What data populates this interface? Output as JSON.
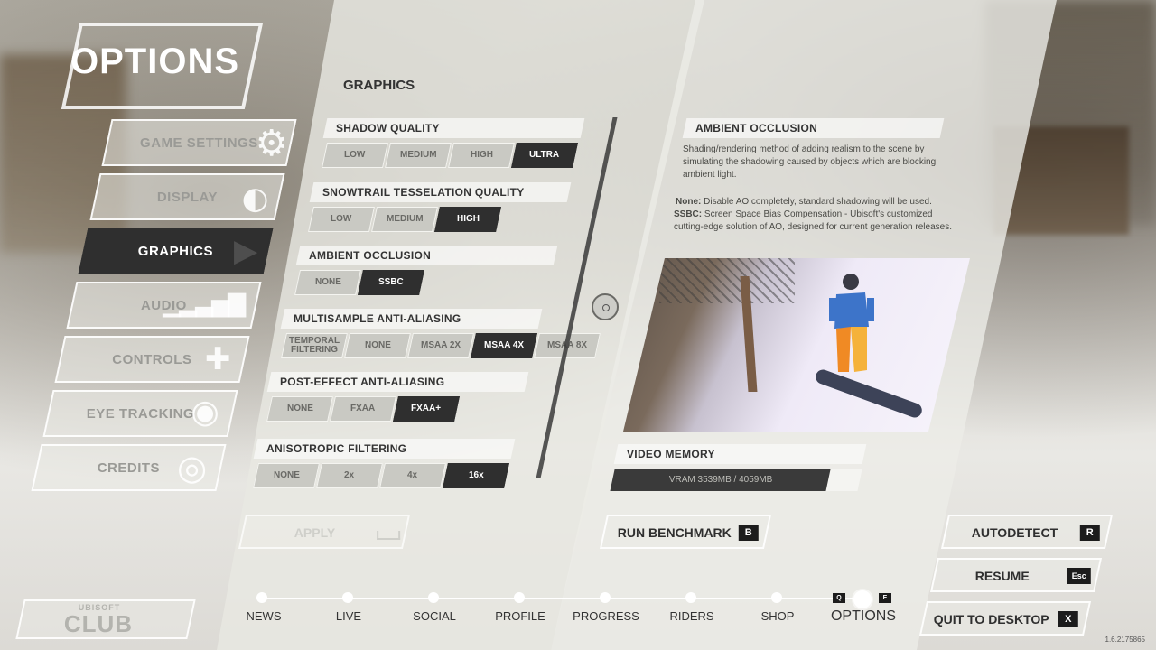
{
  "title": "OPTIONS",
  "nav": [
    {
      "label": "GAME SETTINGS",
      "active": false
    },
    {
      "label": "DISPLAY",
      "active": false
    },
    {
      "label": "GRAPHICS",
      "active": true
    },
    {
      "label": "AUDIO",
      "active": false
    },
    {
      "label": "CONTROLS",
      "active": false
    },
    {
      "label": "EYE TRACKING",
      "active": false
    },
    {
      "label": "CREDITS",
      "active": false
    }
  ],
  "graphics": {
    "heading": "GRAPHICS",
    "sections": [
      {
        "label": "SHADOW QUALITY",
        "options": [
          "LOW",
          "MEDIUM",
          "HIGH",
          "ULTRA"
        ],
        "selected": "ULTRA"
      },
      {
        "label": "SNOWTRAIL TESSELATION QUALITY",
        "options": [
          "LOW",
          "MEDIUM",
          "HIGH"
        ],
        "selected": "HIGH"
      },
      {
        "label": "AMBIENT OCCLUSION",
        "options": [
          "NONE",
          "SSBC"
        ],
        "selected": "SSBC"
      },
      {
        "label": "MULTISAMPLE ANTI-ALIASING",
        "options": [
          "TEMPORAL FILTERING",
          "NONE",
          "MSAA 2X",
          "MSAA 4X",
          "MSAA 8X"
        ],
        "selected": "MSAA 4X"
      },
      {
        "label": "POST-EFFECT ANTI-ALIASING",
        "options": [
          "NONE",
          "FXAA",
          "FXAA+"
        ],
        "selected": "FXAA+"
      },
      {
        "label": "ANISOTROPIC FILTERING",
        "options": [
          "NONE",
          "2x",
          "4x",
          "16x"
        ],
        "selected": "16x"
      }
    ],
    "apply_label": "APPLY"
  },
  "info": {
    "title": "AMBIENT OCCLUSION",
    "description": "Shading/rendering method of adding realism to the scene by simulating the shadowing caused by objects which are blocking ambient light.",
    "none_label": "None:",
    "none_text": "Disable AO completely, standard shadowing will be used.",
    "ssbc_label": "SSBC:",
    "ssbc_text": "Screen Space Bias Compensation - Ubisoft's customized cutting-edge solution of AO, designed for current generation releases."
  },
  "video_memory": {
    "label": "VIDEO MEMORY",
    "text": "VRAM 3539MB / 4059MB",
    "used": 3539,
    "total": 4059
  },
  "buttons": {
    "benchmark": {
      "label": "RUN BENCHMARK",
      "key": "B"
    },
    "autodetect": {
      "label": "AUTODETECT",
      "key": "R"
    },
    "resume": {
      "label": "RESUME",
      "key": "Esc"
    },
    "quit": {
      "label": "QUIT TO DESKTOP",
      "key": "X"
    }
  },
  "club": {
    "top": "UBISOFT",
    "main": "CLUB"
  },
  "bottom_nav": {
    "items": [
      "NEWS",
      "LIVE",
      "SOCIAL",
      "PROFILE",
      "PROGRESS",
      "RIDERS",
      "SHOP",
      "OPTIONS"
    ],
    "active": "OPTIONS",
    "prev_key": "Q",
    "next_key": "E"
  },
  "version": "1.6.2175865",
  "colors": {
    "accent": "#2f2f2f",
    "panel": "#e8e8e2",
    "text": "#333333"
  }
}
